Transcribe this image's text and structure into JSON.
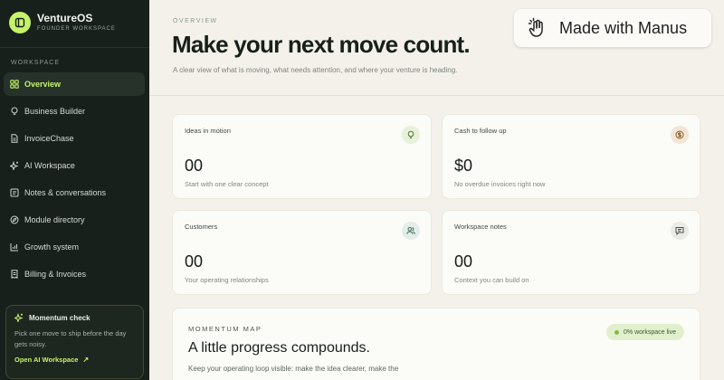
{
  "brand": {
    "name": "VentureOS",
    "subtitle": "FOUNDER WORKSPACE"
  },
  "sidebar": {
    "section_label": "WORKSPACE",
    "items": [
      {
        "label": "Overview",
        "icon": "grid-icon",
        "active": true
      },
      {
        "label": "Business Builder",
        "icon": "lightbulb-icon",
        "active": false
      },
      {
        "label": "InvoiceChase",
        "icon": "file-icon",
        "active": false
      },
      {
        "label": "AI Workspace",
        "icon": "sparkles-icon",
        "active": false
      },
      {
        "label": "Notes & conversations",
        "icon": "notes-icon",
        "active": false
      },
      {
        "label": "Module directory",
        "icon": "compass-icon",
        "active": false
      },
      {
        "label": "Growth system",
        "icon": "chart-icon",
        "active": false
      },
      {
        "label": "Billing & Invoices",
        "icon": "receipt-icon",
        "active": false
      }
    ],
    "momentum": {
      "title": "Momentum check",
      "text": "Pick one move to ship before the day gets noisy.",
      "link": "Open AI Workspace",
      "link_arrow": "↗"
    }
  },
  "header": {
    "eyebrow": "OVERVIEW",
    "title": "Make your next move count.",
    "subtitle": "A clear view of what is moving, what needs attention, and where your venture is heading.",
    "badge": "Made with Manus"
  },
  "cards": [
    {
      "title": "Ideas in motion",
      "value": "00",
      "desc": "Start with one clear concept",
      "icon": "lightbulb-icon",
      "icon_bg": "#e8f1d9",
      "icon_color": "#4a7a2a"
    },
    {
      "title": "Cash to follow up",
      "value": "$0",
      "desc": "No overdue invoices right now",
      "icon": "dollar-icon",
      "icon_bg": "#f3e6d6",
      "icon_color": "#8a5a2a"
    },
    {
      "title": "Customers",
      "value": "00",
      "desc": "Your operating relationships",
      "icon": "users-icon",
      "icon_bg": "#e2ede9",
      "icon_color": "#3d6a5a"
    },
    {
      "title": "Workspace notes",
      "value": "00",
      "desc": "Context you can build on",
      "icon": "message-icon",
      "icon_bg": "#ebebe6",
      "icon_color": "#4b524c"
    }
  ],
  "momentum_map": {
    "eyebrow": "MOMENTUM MAP",
    "title": "A little progress compounds.",
    "text": "Keep your operating loop visible: make the idea clearer, make the",
    "pill": "0% workspace live"
  },
  "colors": {
    "accent": "#c6f26a",
    "sidebar_bg": "#18201b",
    "page_bg": "#f3f1ea"
  }
}
